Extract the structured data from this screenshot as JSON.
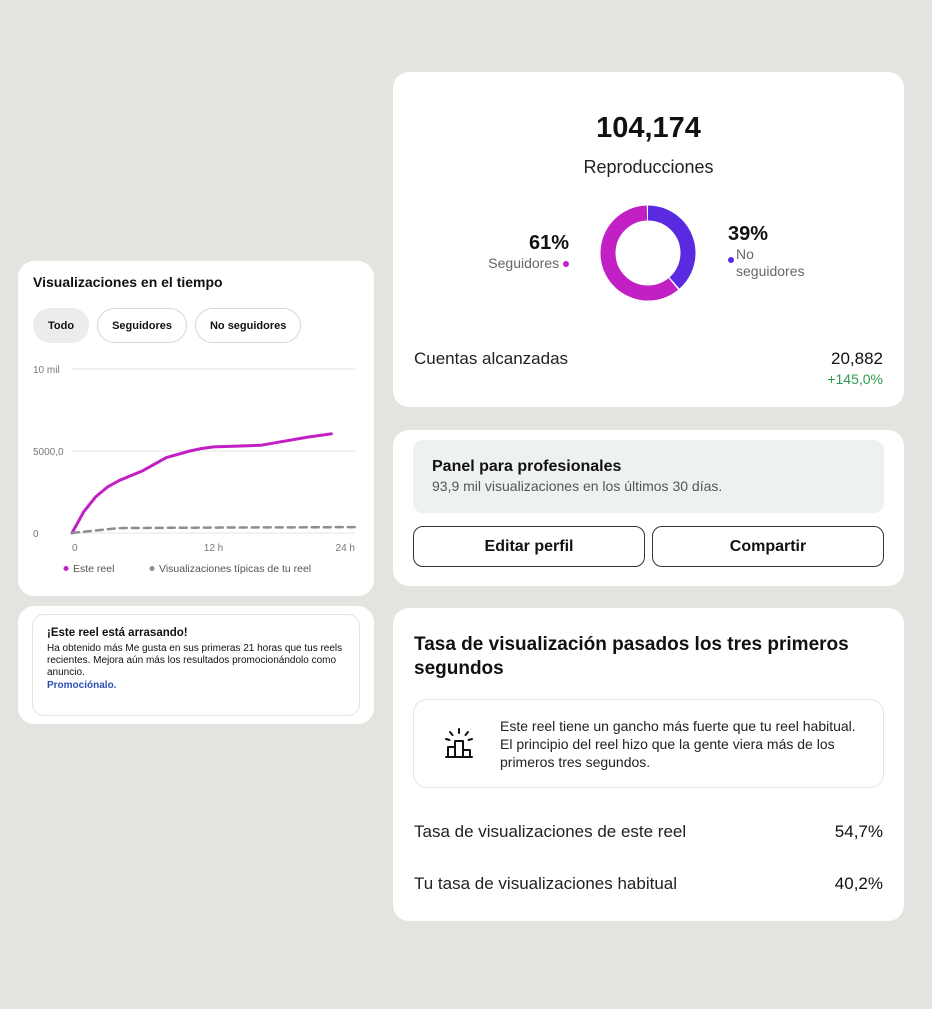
{
  "views_card": {
    "title": "Visualizaciones en el tiempo",
    "filters": [
      "Todo",
      "Seguidores",
      "No seguidores"
    ],
    "active_filter": "Todo",
    "legend": [
      "Este reel",
      "Visualizaciones típicas de tu reel"
    ]
  },
  "chart_data": {
    "type": "line",
    "title": "Visualizaciones en el tiempo",
    "xlabel": "",
    "ylabel": "",
    "x_ticks": [
      "0",
      "12 h",
      "24 h"
    ],
    "y_ticks": [
      "0",
      "5000,0",
      "10 mil"
    ],
    "xlim": [
      0,
      24
    ],
    "ylim": [
      0,
      10000
    ],
    "grid": true,
    "legend_position": "bottom",
    "series": [
      {
        "name": "Este reel",
        "color": "#c21fc4",
        "style": "solid",
        "x": [
          0,
          1,
          2,
          3,
          4,
          6,
          8,
          10,
          11,
          12,
          14,
          16,
          18,
          20,
          22
        ],
        "y": [
          0,
          1300,
          2200,
          2800,
          3200,
          3800,
          4600,
          5000,
          5150,
          5250,
          5300,
          5350,
          5600,
          5850,
          6050
        ]
      },
      {
        "name": "Visualizaciones típicas de tu reel",
        "color": "#8e8e8e",
        "style": "dashed",
        "x": [
          0,
          2,
          4,
          8,
          12,
          16,
          20,
          24
        ],
        "y": [
          0,
          150,
          300,
          320,
          330,
          340,
          350,
          360
        ]
      }
    ]
  },
  "promo": {
    "title": "¡Este reel está arrasando!",
    "body": "Ha obtenido más Me gusta en sus primeras 21 horas que tus reels recientes. Mejora aún más los resultados promocionándolo como anuncio.",
    "link": "Promociónalo."
  },
  "plays": {
    "total": "104,174",
    "label": "Reproducciones",
    "followers_pct": "61%",
    "followers_label": "Seguidores",
    "followers_share": 0.61,
    "followers_color": "#c21fc4",
    "nonfollowers_pct": "39%",
    "nonfollowers_label_1": "No",
    "nonfollowers_label_2": "seguidores",
    "nonfollowers_share": 0.39,
    "nonfollowers_color": "#5a2ae0",
    "reach_label": "Cuentas alcanzadas",
    "reach_value": "20,882",
    "reach_delta": "+145,0%"
  },
  "pro_panel": {
    "title": "Panel para profesionales",
    "subtitle": "93,9 mil visualizaciones en los últimos 30 días.",
    "edit_label": "Editar perfil",
    "share_label": "Compartir"
  },
  "retention": {
    "title": "Tasa de visualización pasados los tres primeros segundos",
    "hook_icon": "podium-sparkle-icon",
    "hook_text": "Este reel tiene un gancho más fuerte que tu reel habitual. El principio del reel hizo que la gente viera más de los primeros tres segundos.",
    "rows": [
      {
        "label": "Tasa de visualizaciones de este reel",
        "value": "54,7%"
      },
      {
        "label": "Tu tasa de visualizaciones habitual",
        "value": "40,2%"
      }
    ]
  }
}
